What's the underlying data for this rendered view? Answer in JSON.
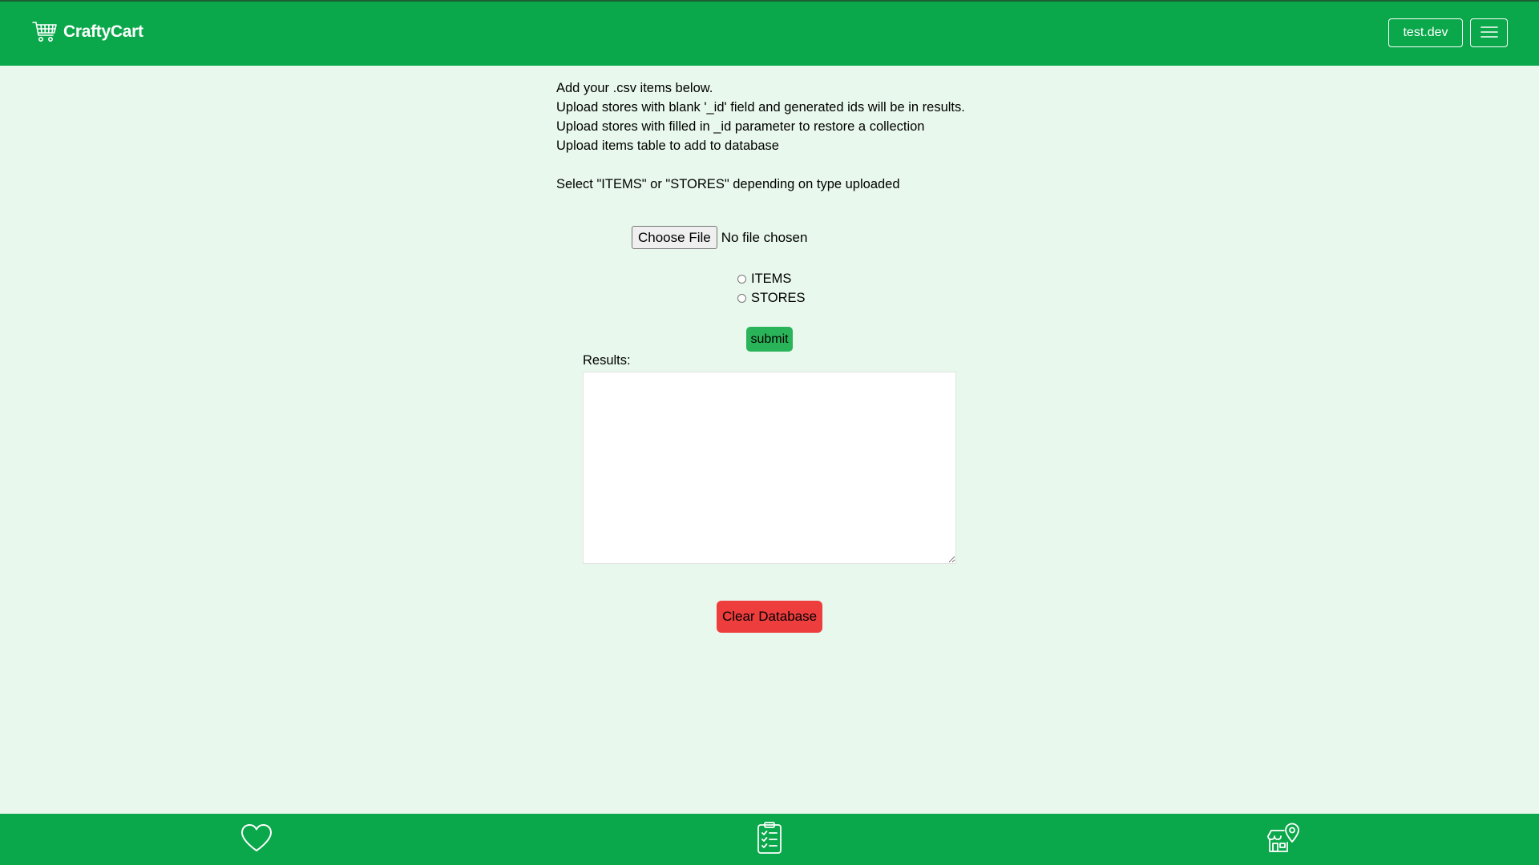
{
  "header": {
    "brand_name": "CraftyCart",
    "brand_icon": "shopping-cart-icon",
    "user_label": "test.dev",
    "menu_icon": "hamburger-menu-icon"
  },
  "instructions": {
    "line1": "Add your .csv items below.",
    "line2": "Upload stores with blank '_id' field and generated ids will be in results.",
    "line3": "Upload stores with filled in _id parameter to restore a collection",
    "line4": "Upload items table to add to database",
    "line5": "Select \"ITEMS\" or \"STORES\" depending on type uploaded"
  },
  "upload": {
    "choose_label": "Choose File",
    "status": "No file chosen"
  },
  "type_options": [
    {
      "label": "ITEMS",
      "checked": false
    },
    {
      "label": "STORES",
      "checked": false
    }
  ],
  "submit_label": "submit",
  "results": {
    "label": "Results:",
    "value": ""
  },
  "clear_label": "Clear Database",
  "bottom_nav": [
    {
      "icon": "heart-icon"
    },
    {
      "icon": "checklist-icon"
    },
    {
      "icon": "store-location-icon"
    }
  ],
  "colors": {
    "brand_green": "#0ba84b",
    "background": "#e8f8ec",
    "submit_green": "#2ab45a",
    "danger_red": "#ee3d3d"
  }
}
